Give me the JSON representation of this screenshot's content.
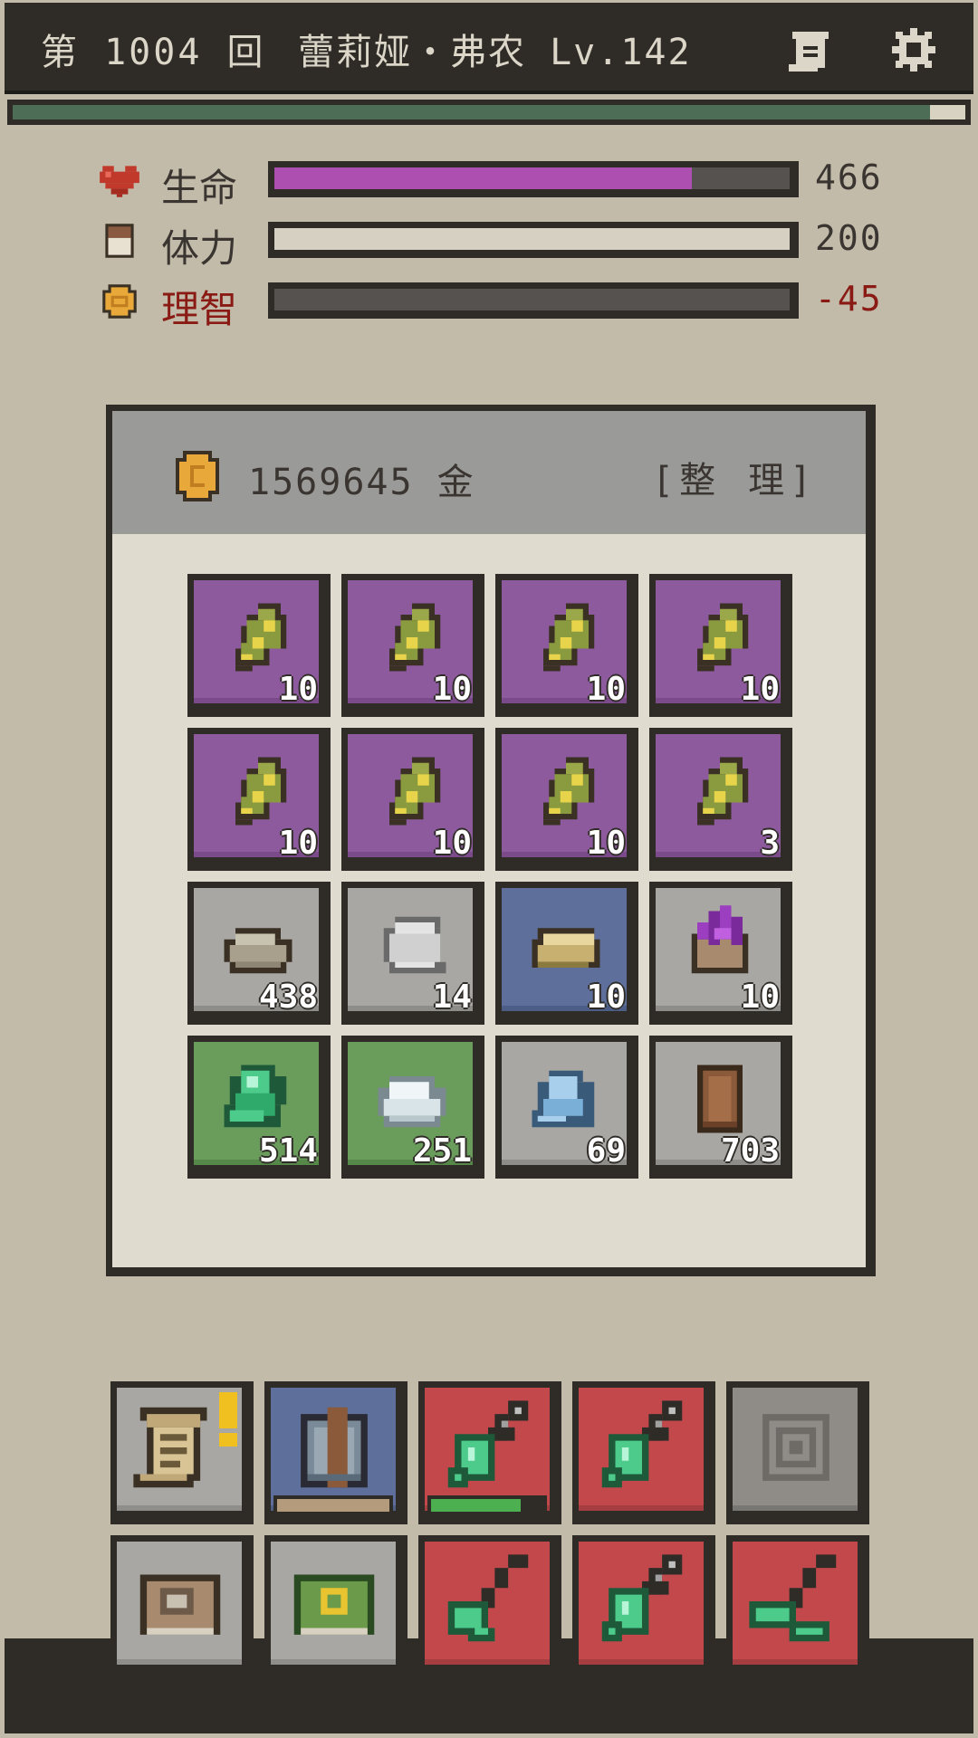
{
  "header": {
    "turn": "第 1004 回",
    "character": "蕾莉娅・弗农 Lv.142",
    "xp_fraction": 0.963
  },
  "stats": [
    {
      "id": "hp",
      "label": "生命",
      "value": "466",
      "fraction": 0.81,
      "color": "#ad4fb0",
      "label_color": "#3a3530"
    },
    {
      "id": "stamina",
      "label": "体力",
      "value": "200",
      "fraction": 1.0,
      "color": "#d6d0c2",
      "label_color": "#3a3530"
    },
    {
      "id": "sanity",
      "label": "理智",
      "value": "-45",
      "fraction": 0.0,
      "color": "#555250",
      "label_color": "#8a1a14"
    }
  ],
  "inventory": {
    "gold": "1569645 金",
    "sort_label": "[整 理]",
    "slots": [
      {
        "item": "seed",
        "bg": "purple",
        "count": "10"
      },
      {
        "item": "seed",
        "bg": "purple",
        "count": "10"
      },
      {
        "item": "seed",
        "bg": "purple",
        "count": "10"
      },
      {
        "item": "seed",
        "bg": "purple",
        "count": "10"
      },
      {
        "item": "seed",
        "bg": "purple",
        "count": "10"
      },
      {
        "item": "seed",
        "bg": "purple",
        "count": "10"
      },
      {
        "item": "seed",
        "bg": "purple",
        "count": "10"
      },
      {
        "item": "seed",
        "bg": "purple",
        "count": "3"
      },
      {
        "item": "stone",
        "bg": "gray",
        "count": "438"
      },
      {
        "item": "iron-plate",
        "bg": "gray",
        "count": "14"
      },
      {
        "item": "gold-ore",
        "bg": "blue",
        "count": "10"
      },
      {
        "item": "cursed-tome",
        "bg": "gray",
        "count": "10"
      },
      {
        "item": "emerald-ore",
        "bg": "green",
        "count": "514"
      },
      {
        "item": "silver-ore",
        "bg": "green",
        "count": "251"
      },
      {
        "item": "crystal-ore",
        "bg": "gray",
        "count": "69"
      },
      {
        "item": "wood-log",
        "bg": "gray",
        "count": "703"
      }
    ]
  },
  "hotbar": [
    {
      "item": "quest-scroll",
      "bg": "gray",
      "alert": true
    },
    {
      "item": "backpack",
      "bg": "blue",
      "bar": {
        "fraction": 1.0,
        "color": "#b39b7c"
      }
    },
    {
      "item": "emerald-sword",
      "bg": "red",
      "bar": {
        "fraction": 0.8,
        "color": "#4caf50"
      }
    },
    {
      "item": "emerald-sword",
      "bg": "red"
    },
    {
      "item": "locked-slot",
      "bg": "dgray"
    },
    {
      "item": "book",
      "bg": "gray"
    },
    {
      "item": "green-book",
      "bg": "gray"
    },
    {
      "item": "emerald-axe",
      "bg": "red"
    },
    {
      "item": "emerald-sword",
      "bg": "red"
    },
    {
      "item": "emerald-pickaxe",
      "bg": "red"
    }
  ]
}
